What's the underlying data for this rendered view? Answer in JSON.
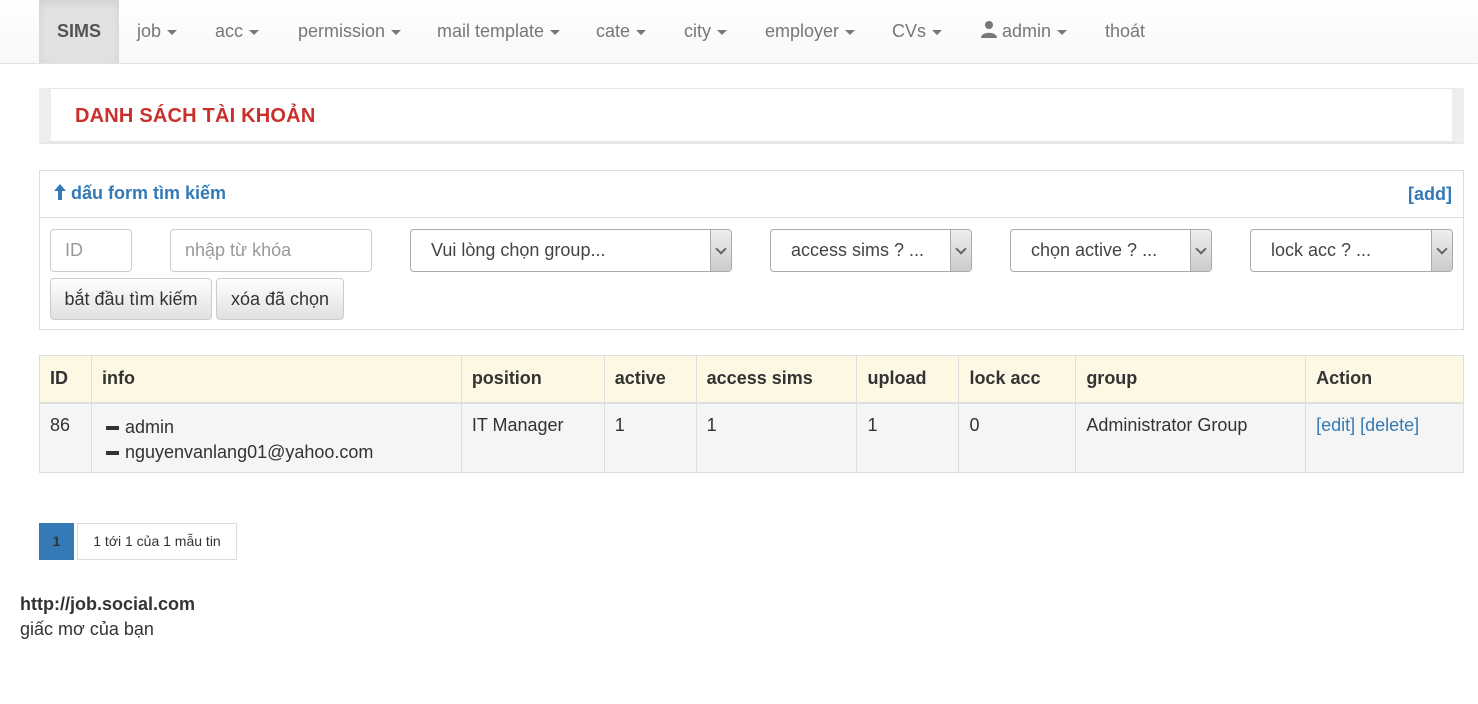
{
  "nav": {
    "brand": "SIMS",
    "items": [
      {
        "label": "job"
      },
      {
        "label": "acc"
      },
      {
        "label": "permission"
      },
      {
        "label": "mail template"
      },
      {
        "label": "cate"
      },
      {
        "label": "city"
      },
      {
        "label": "employer"
      },
      {
        "label": "CVs"
      },
      {
        "label": "admin"
      }
    ],
    "logout": "thoát"
  },
  "page_title": "DANH SÁCH TÀI KHOẢN",
  "search": {
    "toggle_label": "dấu form tìm kiếm",
    "add_label": "[add]",
    "id_placeholder": "ID",
    "keyword_placeholder": "nhập từ khóa",
    "group_select": "Vui lòng chọn group...",
    "access_select": "access sims ? ...",
    "active_select": "chọn active ? ...",
    "lock_select": "lock acc ? ...",
    "search_button": "bắt đầu tìm kiếm",
    "clear_button": "xóa đã chọn"
  },
  "table": {
    "headers": [
      "ID",
      "info",
      "position",
      "active",
      "access sims",
      "upload",
      "lock acc",
      "group",
      "Action"
    ],
    "rows": [
      {
        "id": "86",
        "info_name": "admin",
        "info_email": "nguyenvanlang01@yahoo.com",
        "position": "IT Manager",
        "active": "1",
        "access_sims": "1",
        "upload": "1",
        "lock_acc": "0",
        "group": "Administrator Group",
        "edit": "[edit]",
        "delete": "[delete]"
      }
    ]
  },
  "pagination": {
    "current": "1",
    "info": "1 tới 1 của 1 mẫu tin"
  },
  "footer": {
    "site": "http://job.social.com",
    "slogan": "giấc mơ của bạn"
  },
  "colors": {
    "accent": "#337ab7",
    "title_red": "#c9302c",
    "table_header_bg": "#fcf8e3"
  }
}
